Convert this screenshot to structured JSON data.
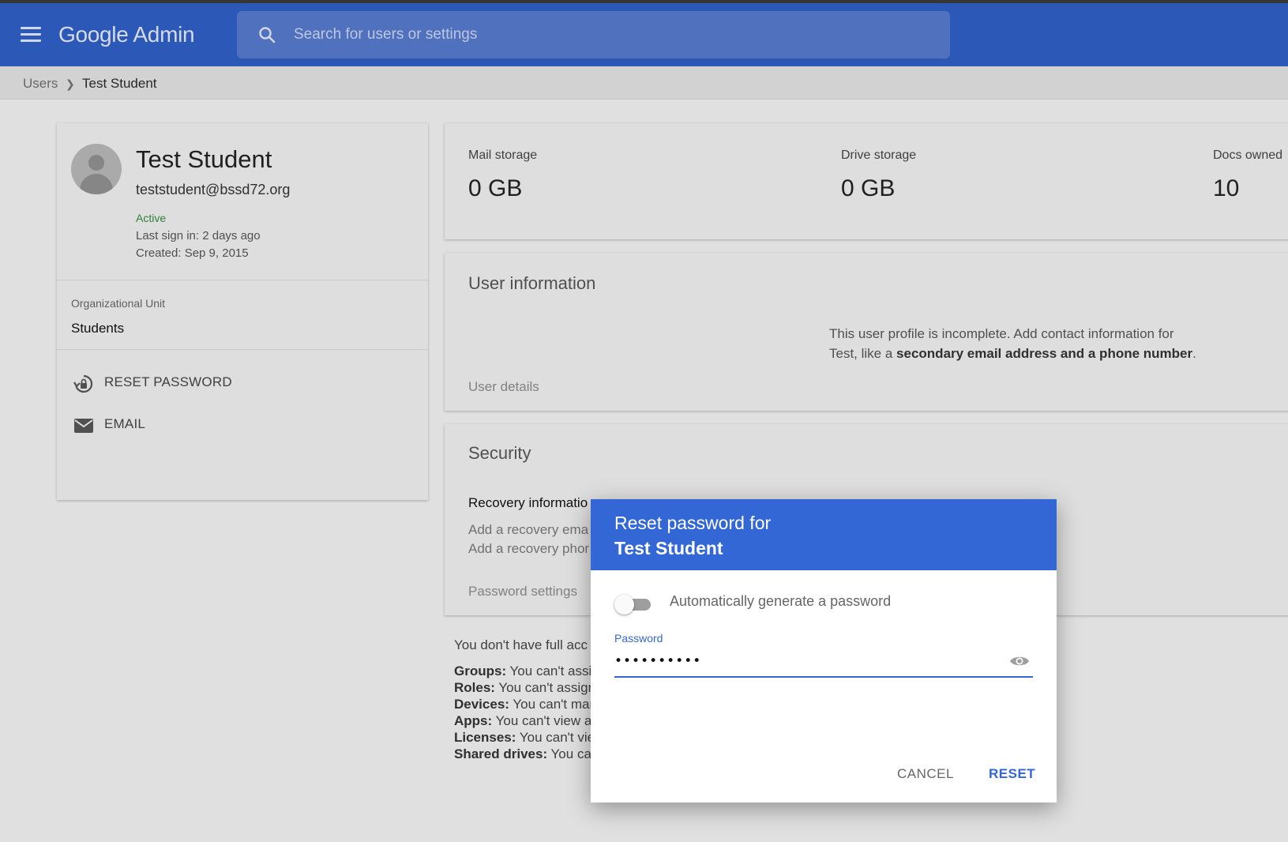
{
  "header": {
    "logo": "Google Admin",
    "search_placeholder": "Search for users or settings"
  },
  "breadcrumb": {
    "root": "Users",
    "current": "Test Student"
  },
  "profile": {
    "name": "Test Student",
    "email": "teststudent@bssd72.org",
    "status": "Active",
    "last_sign_in": "Last sign in: 2 days ago",
    "created": "Created: Sep 9, 2015",
    "org_unit_label": "Organizational Unit",
    "org_unit_value": "Students",
    "actions": [
      {
        "label": "RESET PASSWORD",
        "icon": "lock-reset-icon"
      },
      {
        "label": "EMAIL",
        "icon": "mail-icon"
      }
    ]
  },
  "storage": {
    "mail_label": "Mail storage",
    "mail_value": "0 GB",
    "drive_label": "Drive storage",
    "drive_value": "0 GB",
    "docs_label": "Docs owned",
    "docs_value": "10"
  },
  "user_info": {
    "title": "User information",
    "message_start": "This user profile is incomplete. Add contact information for Test, like a ",
    "message_bold": "secondary email address and a phone number",
    "message_end": ".",
    "details_link": "User details"
  },
  "security": {
    "title": "Security",
    "recovery_heading": "Recovery informatio",
    "line1": "Add a recovery ema",
    "line2": "Add a recovery phor",
    "password_settings": "Password settings"
  },
  "access": {
    "intro": "You don't have full acc",
    "rows": [
      {
        "key": "Groups:",
        "text": "You can't assi"
      },
      {
        "key": "Roles:",
        "text": "You can't assigr"
      },
      {
        "key": "Devices:",
        "text": "You can't mar"
      },
      {
        "key": "Apps:",
        "text": "You can't view a"
      },
      {
        "key": "Licenses:",
        "text": "You can't vie"
      },
      {
        "key": "Shared drives:",
        "text": "You car"
      }
    ]
  },
  "dialog": {
    "title_line1": "Reset password for",
    "title_line2": "Test Student",
    "toggle_label": "Automatically generate a password",
    "toggle_on": false,
    "password_label": "Password",
    "password_value": "••••••••••",
    "cancel_label": "CANCEL",
    "reset_label": "RESET",
    "accent_color": "#3367d6"
  }
}
